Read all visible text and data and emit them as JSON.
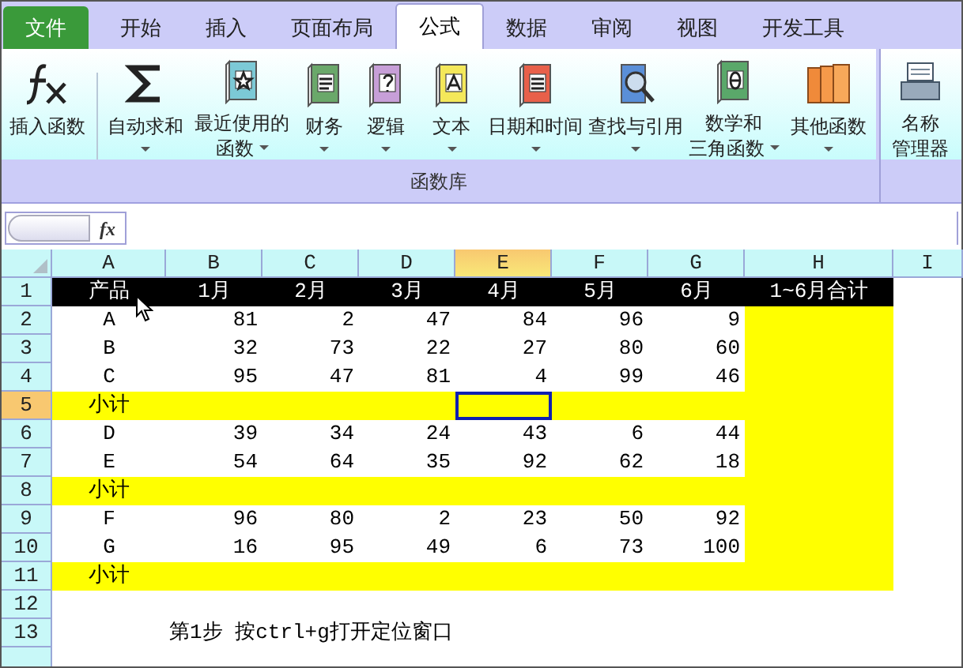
{
  "tabs": [
    {
      "label": "文件",
      "kind": "file",
      "selected": false
    },
    {
      "label": "开始",
      "kind": "tab",
      "selected": false
    },
    {
      "label": "插入",
      "kind": "tab",
      "selected": false
    },
    {
      "label": "页面布局",
      "kind": "tab",
      "selected": false
    },
    {
      "label": "公式",
      "kind": "tab",
      "selected": true
    },
    {
      "label": "数据",
      "kind": "tab",
      "selected": false
    },
    {
      "label": "审阅",
      "kind": "tab",
      "selected": false
    },
    {
      "label": "视图",
      "kind": "tab",
      "selected": false
    },
    {
      "label": "开发工具",
      "kind": "tab",
      "selected": false
    }
  ],
  "ribbon": {
    "groups": [
      {
        "label": "函数库",
        "buttons": [
          {
            "lines": [
              "插入函数"
            ],
            "dropdown": false
          },
          {
            "lines": [
              "自动求和"
            ],
            "dropdown": true
          },
          {
            "lines": [
              "最近使用的",
              "函数"
            ],
            "dropdown": true
          },
          {
            "lines": [
              "财务"
            ],
            "dropdown": true
          },
          {
            "lines": [
              "逻辑"
            ],
            "dropdown": true
          },
          {
            "lines": [
              "文本"
            ],
            "dropdown": true
          },
          {
            "lines": [
              "日期和时间"
            ],
            "dropdown": true
          },
          {
            "lines": [
              "查找与引用"
            ],
            "dropdown": true
          },
          {
            "lines": [
              "数学和",
              "三角函数"
            ],
            "dropdown": true
          },
          {
            "lines": [
              "其他函数"
            ],
            "dropdown": true
          }
        ]
      },
      {
        "buttons": [
          {
            "lines": [
              "名称",
              "管理器"
            ],
            "dropdown": false
          }
        ]
      }
    ]
  },
  "formula_bar": {
    "fx": "fx"
  },
  "sheet": {
    "columns": [
      {
        "label": "A",
        "selected": false
      },
      {
        "label": "B",
        "selected": false
      },
      {
        "label": "C",
        "selected": false
      },
      {
        "label": "D",
        "selected": false
      },
      {
        "label": "E",
        "selected": true
      },
      {
        "label": "F",
        "selected": false
      },
      {
        "label": "G",
        "selected": false
      },
      {
        "label": "H",
        "selected": false
      },
      {
        "label": "I",
        "selected": false
      }
    ],
    "rows": [
      {
        "label": "1",
        "kind": "header",
        "selected": false,
        "cells": [
          "产品",
          "1月",
          "2月",
          "3月",
          "4月",
          "5月",
          "6月",
          "1~6月合计"
        ]
      },
      {
        "label": "2",
        "kind": "data",
        "selected": false,
        "cells": [
          "A",
          "81",
          "2",
          "47",
          "84",
          "96",
          "9"
        ]
      },
      {
        "label": "3",
        "kind": "data",
        "selected": false,
        "cells": [
          "B",
          "32",
          "73",
          "22",
          "27",
          "80",
          "60"
        ]
      },
      {
        "label": "4",
        "kind": "data",
        "selected": false,
        "cells": [
          "C",
          "95",
          "47",
          "81",
          "4",
          "99",
          "46"
        ]
      },
      {
        "label": "5",
        "kind": "subtotal",
        "selected": true,
        "cells": [
          "小计"
        ]
      },
      {
        "label": "6",
        "kind": "data",
        "selected": false,
        "cells": [
          "D",
          "39",
          "34",
          "24",
          "43",
          "6",
          "44"
        ]
      },
      {
        "label": "7",
        "kind": "data",
        "selected": false,
        "cells": [
          "E",
          "54",
          "64",
          "35",
          "92",
          "62",
          "18"
        ]
      },
      {
        "label": "8",
        "kind": "subtotal",
        "selected": false,
        "cells": [
          "小计"
        ]
      },
      {
        "label": "9",
        "kind": "data",
        "selected": false,
        "cells": [
          "F",
          "96",
          "80",
          "2",
          "23",
          "50",
          "92"
        ]
      },
      {
        "label": "10",
        "kind": "data",
        "selected": false,
        "cells": [
          "G",
          "16",
          "95",
          "49",
          "6",
          "73",
          "100"
        ]
      },
      {
        "label": "11",
        "kind": "subtotal",
        "selected": false,
        "cells": [
          "小计"
        ]
      },
      {
        "label": "12",
        "kind": "blank",
        "selected": false
      },
      {
        "label": "13",
        "kind": "note",
        "selected": false,
        "note": "第1步 按ctrl+g打开定位窗口"
      }
    ]
  }
}
